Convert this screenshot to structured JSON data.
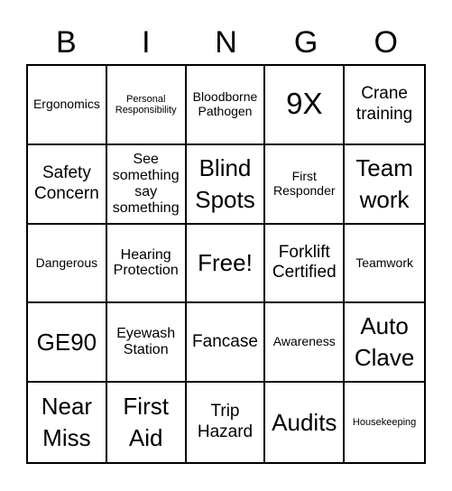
{
  "header": [
    "B",
    "I",
    "N",
    "G",
    "O"
  ],
  "cells": [
    {
      "text": "Ergonomics",
      "size": "s-sm"
    },
    {
      "text": "Personal Responsibility",
      "size": "s-xs"
    },
    {
      "text": "Bloodborne Pathogen",
      "size": "s-sm"
    },
    {
      "text": "9X",
      "size": "s-xxl"
    },
    {
      "text": "Crane training",
      "size": "s-lg"
    },
    {
      "text": "Safety Concern",
      "size": "s-lg"
    },
    {
      "text": "See something say something",
      "size": "s-md"
    },
    {
      "text": "Blind Spots",
      "size": "s-xl"
    },
    {
      "text": "First Responder",
      "size": "s-sm"
    },
    {
      "text": "Team work",
      "size": "s-xl"
    },
    {
      "text": "Dangerous",
      "size": "s-sm"
    },
    {
      "text": "Hearing Protection",
      "size": "s-md"
    },
    {
      "text": "Free!",
      "size": "s-xl"
    },
    {
      "text": "Forklift Certified",
      "size": "s-lg"
    },
    {
      "text": "Teamwork",
      "size": "s-sm"
    },
    {
      "text": "GE90",
      "size": "s-xl"
    },
    {
      "text": "Eyewash Station",
      "size": "s-md"
    },
    {
      "text": "Fancase",
      "size": "s-lg"
    },
    {
      "text": "Awareness",
      "size": "s-sm"
    },
    {
      "text": "Auto Clave",
      "size": "s-xl"
    },
    {
      "text": "Near Miss",
      "size": "s-xl"
    },
    {
      "text": "First Aid",
      "size": "s-xl"
    },
    {
      "text": "Trip Hazard",
      "size": "s-lg"
    },
    {
      "text": "Audits",
      "size": "s-xl"
    },
    {
      "text": "Housekeeping",
      "size": "s-xs"
    }
  ]
}
